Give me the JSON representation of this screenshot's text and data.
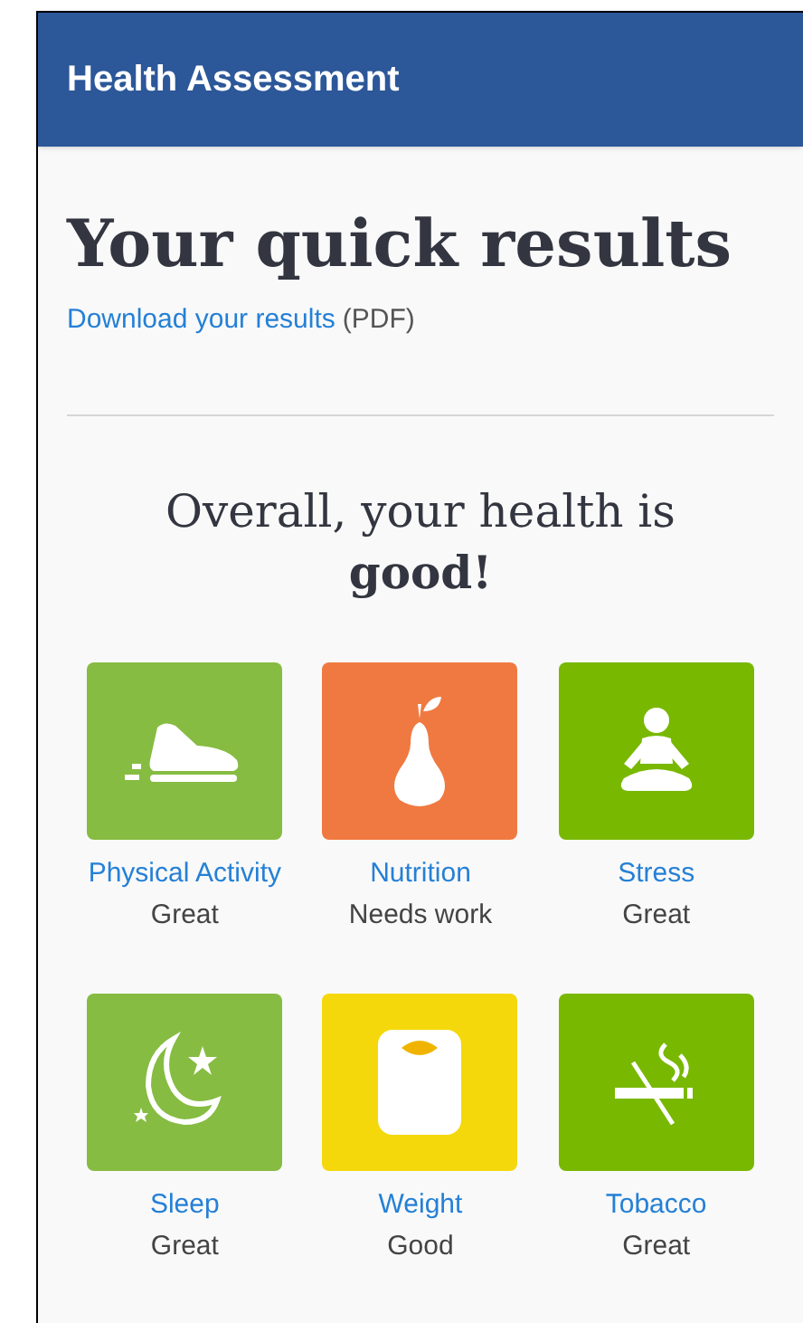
{
  "header": {
    "title": "Health Assessment"
  },
  "heading": "Your quick results",
  "download": {
    "link": "Download your results",
    "note": "(PDF)"
  },
  "summary": "Overall, your health is **good!**",
  "categories": [
    {
      "name": "Physical Activity",
      "rating": "Great",
      "color": "#86bc42"
    },
    {
      "name": "Nutrition",
      "rating": "Needs work",
      "color": "#f07941"
    },
    {
      "name": "Stress",
      "rating": "Great",
      "color": "#78b800"
    },
    {
      "name": "Sleep",
      "rating": "Great",
      "color": "#86bc42"
    },
    {
      "name": "Weight",
      "rating": "Good",
      "color": "#f5d80c"
    },
    {
      "name": "Tobacco",
      "rating": "Great",
      "color": "#78b800"
    }
  ]
}
